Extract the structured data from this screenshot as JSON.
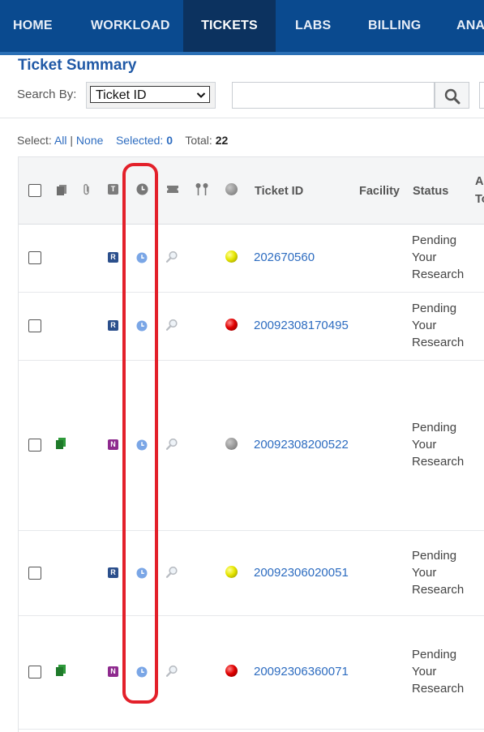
{
  "nav": {
    "items": [
      "HOME",
      "WORKLOAD",
      "TICKETS",
      "LABS",
      "BILLING",
      "ANA"
    ],
    "active": "TICKETS"
  },
  "page_title": "Ticket Summary",
  "search": {
    "label": "Search By:",
    "field_value": "Ticket ID",
    "input_value": ""
  },
  "selection": {
    "label": "Select:",
    "all": "All",
    "separator": "|",
    "none": "None",
    "selected_label": "Selected:",
    "selected_count": "0",
    "total_label": "Total:",
    "total_count": "22"
  },
  "table": {
    "headers": {
      "ticket_id": "Ticket ID",
      "facility": "Facility",
      "status": "Status",
      "assigned_partial_1": "As",
      "assigned_partial_2": "To",
      "type_icon_letter": "T"
    },
    "rows": [
      {
        "type_letter": "R",
        "type_color": "#2b4f8c",
        "has_doc": false,
        "ball": "yellow",
        "ticket_id": "202670560",
        "status": [
          "Pending",
          "Your",
          "Research"
        ]
      },
      {
        "type_letter": "R",
        "type_color": "#2b4f8c",
        "has_doc": false,
        "ball": "red",
        "ticket_id": "20092308170495",
        "status": [
          "Pending",
          "Your",
          "Research"
        ]
      },
      {
        "type_letter": "N",
        "type_color": "#8e2a8e",
        "has_doc": true,
        "ball": "gray",
        "ticket_id": "20092308200522",
        "status": [
          "Pending",
          "Your",
          "Research"
        ]
      },
      {
        "type_letter": "R",
        "type_color": "#2b4f8c",
        "has_doc": false,
        "ball": "yellow",
        "ticket_id": "20092306020051",
        "status": [
          "Pending",
          "Your",
          "Research"
        ]
      },
      {
        "type_letter": "N",
        "type_color": "#8e2a8e",
        "has_doc": true,
        "ball": "red",
        "ticket_id": "20092306360071",
        "status": [
          "Pending",
          "Your",
          "Research"
        ]
      }
    ]
  },
  "colors": {
    "nav_bg": "#0a4a8f",
    "nav_active_bg": "#0c325f",
    "link": "#2d6cc0",
    "highlight": "#e3202a"
  }
}
